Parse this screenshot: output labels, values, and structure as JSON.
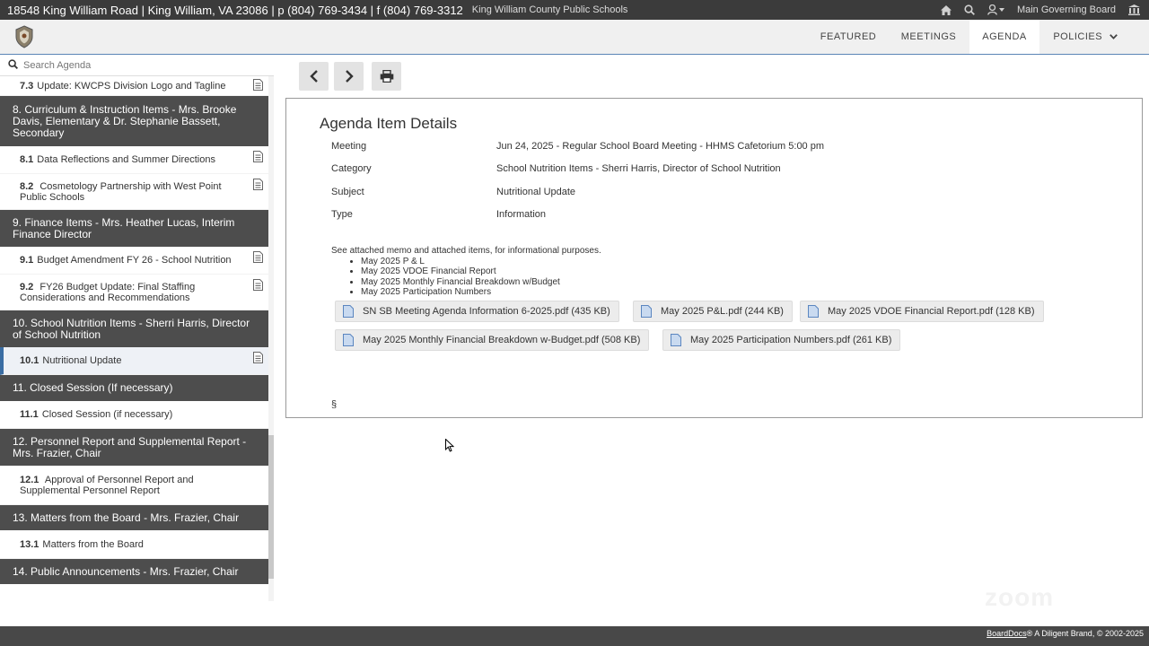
{
  "topbar": {
    "address": "18548 King William Road | King William, VA 23086 | p (804) 769-3434 | f (804) 769-3312",
    "district": "King William County Public Schools",
    "board": "Main Governing Board"
  },
  "nav": {
    "tabs": [
      "FEATURED",
      "MEETINGS",
      "AGENDA",
      "POLICIES"
    ],
    "active": "AGENDA"
  },
  "search": {
    "placeholder": "Search Agenda"
  },
  "agenda": {
    "item_7_3": {
      "num": "7.3",
      "label": "Update: KWCPS Division Logo and Tagline"
    },
    "section_8": "8. Curriculum & Instruction Items - Mrs. Brooke Davis, Elementary & Dr. Stephanie Bassett, Secondary",
    "item_8_1": {
      "num": "8.1",
      "label": "Data Reflections and Summer Directions"
    },
    "item_8_2": {
      "num": "8.2",
      "label": "Cosmetology Partnership with West Point Public Schools"
    },
    "section_9": "9. Finance Items - Mrs. Heather Lucas, Interim Finance Director",
    "item_9_1": {
      "num": "9.1",
      "label": "Budget Amendment FY 26 - School Nutrition"
    },
    "item_9_2": {
      "num": "9.2",
      "label": "FY26 Budget Update: Final Staffing Considerations and Recommendations"
    },
    "section_10": "10. School Nutrition Items - Sherri Harris, Director of School Nutrition",
    "item_10_1": {
      "num": "10.1",
      "label": "Nutritional Update"
    },
    "section_11": "11. Closed Session (If necessary)",
    "item_11_1": {
      "num": "11.1",
      "label": "Closed Session (if necessary)"
    },
    "section_12": "12. Personnel Report and Supplemental Report - Mrs. Frazier, Chair",
    "item_12_1": {
      "num": "12.1",
      "label": "Approval of Personnel Report and Supplemental Personnel Report"
    },
    "section_13": "13. Matters from the Board - Mrs. Frazier, Chair",
    "item_13_1": {
      "num": "13.1",
      "label": "Matters from the Board"
    },
    "section_14": "14. Public Announcements - Mrs. Frazier, Chair"
  },
  "details": {
    "heading": "Agenda Item Details",
    "meeting_label": "Meeting",
    "meeting": "Jun 24, 2025 - Regular School Board Meeting - HHMS Cafetorium 5:00 pm",
    "category_label": "Category",
    "category": "School Nutrition Items - Sherri Harris, Director of School Nutrition",
    "subject_label": "Subject",
    "subject": "Nutritional Update",
    "type_label": "Type",
    "type": "Information",
    "description": "See attached memo and attached items, for informational purposes.",
    "bullets": [
      "May 2025 P & L",
      "May 2025 VDOE Financial Report",
      "May 2025 Monthly Financial Breakdown w/Budget",
      "May 2025 Participation Numbers"
    ],
    "attachments": [
      "SN SB Meeting Agenda Information 6-2025.pdf (435 KB)",
      "May 2025 P&L.pdf (244 KB)",
      "May 2025 VDOE Financial Report.pdf (128 KB)",
      "May 2025 Monthly Financial Breakdown w-Budget.pdf (508 KB)",
      "May 2025 Participation Numbers.pdf (261 KB)"
    ],
    "section_mark": "§"
  },
  "watermark": "zoom",
  "footer": {
    "brand": "BoardDocs",
    "credit": "® A Diligent Brand, © 2002-2025"
  },
  "colors": {
    "topbar": "#3b3b3b",
    "section_header": "#4d4d4d",
    "active_tab": "#ffffff",
    "accent": "#3a6da3",
    "footer": "#484848"
  }
}
